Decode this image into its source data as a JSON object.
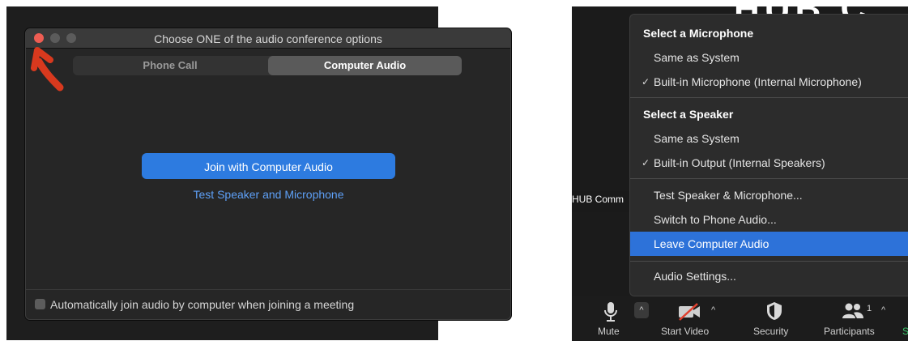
{
  "left_dialog": {
    "title": "Choose ONE of the audio conference options",
    "tabs": [
      "Phone Call",
      "Computer Audio"
    ],
    "selected_tab": "Computer Audio",
    "join_button": "Join with Computer Audio",
    "test_link": "Test Speaker and Microphone",
    "auto_join_label": "Automatically join audio by computer when joining a meeting",
    "auto_join_checked": false
  },
  "right_panel": {
    "background_text": "HUB C",
    "video_name": "HUB Comm",
    "menu": {
      "mic_heading": "Select a Microphone",
      "mic_options": [
        "Same as System",
        "Built-in Microphone (Internal Microphone)"
      ],
      "mic_selected": "Built-in Microphone (Internal Microphone)",
      "speaker_heading": "Select a Speaker",
      "speaker_options": [
        "Same as System",
        "Built-in Output (Internal Speakers)"
      ],
      "speaker_selected": "Built-in Output (Internal Speakers)",
      "actions": [
        "Test Speaker & Microphone...",
        "Switch to Phone Audio...",
        "Leave Computer Audio"
      ],
      "highlighted": "Leave Computer Audio",
      "settings": "Audio Settings..."
    },
    "toolbar": {
      "mute": "Mute",
      "start_video": "Start Video",
      "security": "Security",
      "participants": "Participants",
      "participants_count": "1",
      "partial_label": "S"
    }
  },
  "check_glyph": "✓",
  "caret_glyph": "^",
  "colors": {
    "accent_blue": "#2d7be0",
    "link_blue": "#5ea0f7",
    "close_red": "#ee5d53",
    "annotation_red": "#d8391e",
    "highlight_blue": "#2d72d9"
  }
}
